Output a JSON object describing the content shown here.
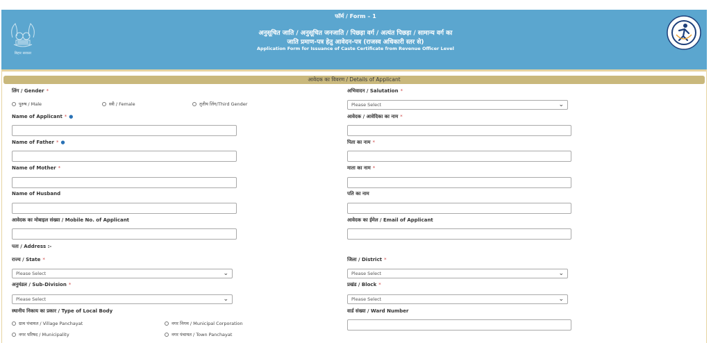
{
  "header": {
    "form_no": "फॉर्म / Form – 1",
    "title_hindi_line1": "अनुसूचित जाति / अनुसूचित जनजाति / पिछड़ा वर्ग / अत्यंत पिछड़ा / सामान्य वर्ग का",
    "title_hindi_line2": "जाति प्रमाण-पत्र हेतु आवेदन-पत्र (राजस्व अधिकारी स्तर से)",
    "title_english": "Application Form for Issuance of Caste Certificate from Revenue Officer Level",
    "left_logo_caption": "बिहार सरकार",
    "left_logo_icon": "bihar-emblem-icon",
    "right_logo_icon": "service-logo-icon"
  },
  "section": {
    "title": "आवेदक का विवरण / Details of Applicant"
  },
  "form": {
    "gender_label": "लिंग / Gender",
    "gender_options": [
      "पुरुष / Male",
      "स्त्री / Female",
      "तृतीय लिंग/Third Gender"
    ],
    "salutation_label": "अभिवादन / Salutation",
    "salutation_value": "Please Select",
    "name_applicant_label": "Name of Applicant",
    "name_applicant_hi_label": "आवेदक / आवेदिका का नाम",
    "name_father_label": "Name of Father",
    "name_father_hi_label": "पिता का नाम",
    "name_mother_label": "Name of Mother",
    "name_mother_hi_label": "माता का नाम",
    "name_husband_label": "Name of Husband",
    "name_husband_hi_label": "पति का नाम",
    "mobile_label": "आवेदक का मोबाइल संख्या / Mobile No. of Applicant",
    "email_label": "आवेदक का ईमेल / Email of Applicant",
    "address_label": "पता / Address :-",
    "state_label": "राज्य / State",
    "state_value": "Please Select",
    "district_label": "जिला / District",
    "district_value": "Please Select",
    "subdivision_label": "अनुमंडल / Sub-Division",
    "subdivision_value": "Please Select",
    "block_label": "प्रखंड / Block",
    "block_value": "Please Select",
    "local_body_label": "स्थानीय निकाय का प्रकार / Type of Local Body",
    "local_body_options": [
      "ग्राम पंचायत / Village Panchayat",
      "नगर निगम / Municipal Corporation",
      "नगर परिषद / Municipality",
      "नगर पंचायत / Town Panchayat"
    ],
    "ward_label": "वार्ड संख्या / Ward Number",
    "required_mark": "*",
    "info_icon": "info-icon",
    "chevron": "⌄"
  },
  "colors": {
    "header_bg": "#5ba6cf",
    "section_bar": "#c9b87c",
    "required": "#d04a4a"
  }
}
